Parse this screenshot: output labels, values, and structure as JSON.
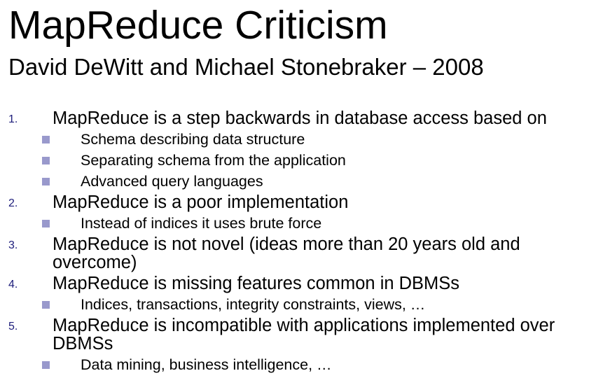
{
  "title": "MapReduce Criticism",
  "subtitle": "David DeWitt and Michael Stonebraker – 2008",
  "colors": {
    "number": "#1c1c7a",
    "bullet": "#9999cc"
  },
  "items": [
    {
      "number": "1.",
      "text": "MapReduce is a step backwards in database access based on",
      "subs": [
        "Schema describing data structure",
        "Separating schema from the application",
        "Advanced query languages"
      ]
    },
    {
      "number": "2.",
      "text": "MapReduce is a poor implementation",
      "subs": [
        "Instead of indices it uses brute force"
      ]
    },
    {
      "number": "3.",
      "text": "MapReduce is not novel (ideas more than 20 years old and overcome)",
      "subs": []
    },
    {
      "number": "4.",
      "text": "MapReduce is missing features common in DBMSs",
      "subs": [
        "Indices, transactions, integrity constraints, views, …"
      ]
    },
    {
      "number": "5.",
      "text": "MapReduce is incompatible with applications implemented over DBMSs",
      "subs": [
        "Data mining, business intelligence, …"
      ]
    }
  ]
}
